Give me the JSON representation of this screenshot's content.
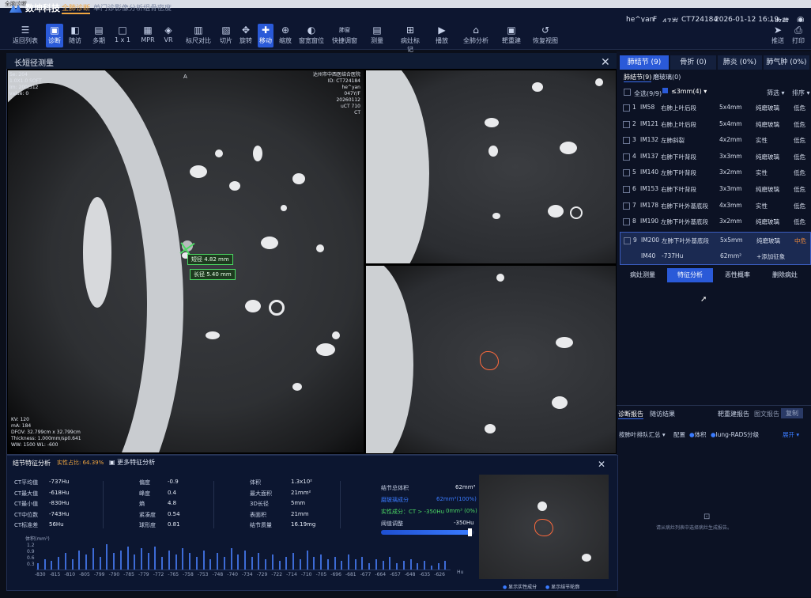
{
  "window": {
    "title": "全脑诊断"
  },
  "brand": {
    "name": "数坤科技"
  },
  "modes": [
    {
      "label": "全肺诊断",
      "active": true
    },
    {
      "label": "单门诊影像分析组",
      "active": false
    },
    {
      "label": "骨密度",
      "active": false
    }
  ],
  "patient": {
    "name": "he^yan",
    "sex": "F",
    "age": "47岁",
    "id": "CT724184",
    "datetime": "2026-01-12 16:19"
  },
  "header_actions": {
    "favorite": "收藏",
    "send": "推送",
    "print": "打印"
  },
  "toolbar": [
    {
      "label": "返回列表",
      "icon": "list-icon",
      "glyph": "☰"
    },
    {
      "label": "诊断",
      "icon": "diagnose-icon",
      "glyph": "▣",
      "active": true
    },
    {
      "label": "随访",
      "icon": "followup-icon",
      "glyph": "◧"
    },
    {
      "label": "多期",
      "icon": "multiphase-icon",
      "glyph": "▤"
    },
    {
      "label": "1 x 1",
      "icon": "layout-icon",
      "glyph": "□"
    },
    {
      "label": "MPR",
      "icon": "mpr-icon",
      "glyph": "▦"
    },
    {
      "label": "VR",
      "icon": "vr-icon",
      "glyph": "◈"
    },
    {
      "label": "标尺对比",
      "icon": "ruler-compare-icon",
      "glyph": "▥"
    },
    {
      "label": "切片",
      "icon": "slice-icon",
      "glyph": "▧"
    },
    {
      "label": "旋转",
      "icon": "rotate-icon",
      "glyph": "✥"
    },
    {
      "label": "移动",
      "icon": "move-icon",
      "glyph": "✚",
      "active": true
    },
    {
      "label": "缩放",
      "icon": "zoom-icon",
      "glyph": "⊕"
    },
    {
      "label": "窗宽窗位",
      "icon": "window-level-icon",
      "glyph": "◐"
    },
    {
      "label": "快捷调窗",
      "icon": "quick-window-icon",
      "glyph": "肺窗"
    },
    {
      "label": "测量",
      "icon": "measure-icon",
      "glyph": "▤"
    },
    {
      "label": "病灶标记",
      "icon": "lesion-mark-icon",
      "glyph": "⊞"
    },
    {
      "label": "播放",
      "icon": "play-icon",
      "glyph": "▶"
    },
    {
      "label": "全肺分析",
      "icon": "lung-analysis-icon",
      "glyph": "⌂"
    },
    {
      "label": "靶重建",
      "icon": "target-recon-icon",
      "glyph": "▣"
    },
    {
      "label": "恢复视图",
      "icon": "reset-view-icon",
      "glyph": "↺"
    }
  ],
  "viewer": {
    "title": "长短径测量",
    "orientation": "A",
    "info_left": [
      "Se: 204",
      "1.0X1.0 SOFT",
      "Im: 200/312",
      "value: 0"
    ],
    "info_right": [
      "达州市中西医结合医院",
      "ID: CT724184",
      "he^yan",
      "047Y/F",
      "20260112",
      "uCT 710",
      "CT"
    ],
    "info_bottom": [
      "KV: 120",
      "mA: 184",
      "DFOV: 32.799cm x 32.799cm",
      "Thickness: 1.000mm/sp0.641",
      "WW: 1500    WL: -600"
    ],
    "short_axis": "短径 4.82 mm",
    "long_axis": "长径 5.40 mm"
  },
  "nodule_panel": {
    "tabs": [
      {
        "label": "肺结节 (9)",
        "active": true
      },
      {
        "label": "骨折 (0)"
      },
      {
        "label": "肺炎 (0%)"
      },
      {
        "label": "肺气肿 (0%)"
      }
    ],
    "subtabs": [
      "肺结节(9)",
      "磨玻璃(0)"
    ],
    "select_all": "全选(9/9)",
    "filter_value": "≤3mm(4)",
    "filter_label": "筛选",
    "sort_label": "排序",
    "rows": [
      {
        "no": "1",
        "im": "IM58",
        "loc": "右肺上叶后段",
        "size": "5x4mm",
        "type": "纯磨玻璃",
        "risk": "低危"
      },
      {
        "no": "2",
        "im": "IM121",
        "loc": "右肺上叶后段",
        "size": "5x4mm",
        "type": "纯磨玻璃",
        "risk": "低危"
      },
      {
        "no": "3",
        "im": "IM132",
        "loc": "左肺斜裂",
        "size": "4x2mm",
        "type": "实性",
        "risk": "低危"
      },
      {
        "no": "4",
        "im": "IM137",
        "loc": "右肺下叶背段",
        "size": "3x3mm",
        "type": "纯磨玻璃",
        "risk": "低危"
      },
      {
        "no": "5",
        "im": "IM140",
        "loc": "左肺下叶背段",
        "size": "3x2mm",
        "type": "实性",
        "risk": "低危"
      },
      {
        "no": "6",
        "im": "IM153",
        "loc": "右肺下叶背段",
        "size": "3x3mm",
        "type": "纯磨玻璃",
        "risk": "低危"
      },
      {
        "no": "7",
        "im": "IM178",
        "loc": "右肺下叶外基底段",
        "size": "4x3mm",
        "type": "实性",
        "risk": "低危"
      },
      {
        "no": "8",
        "im": "IM190",
        "loc": "左肺下叶外基底段",
        "size": "3x2mm",
        "type": "纯磨玻璃",
        "risk": "低危"
      }
    ],
    "selected": {
      "no": "9",
      "im": "IM200",
      "loc": "左肺下叶外基底段",
      "size": "5x5mm",
      "type": "纯磨玻璃",
      "risk": "中危",
      "im2": "IM40",
      "hu": "-737Hu",
      "area": "62mm²",
      "add_sign": "+添加征象"
    },
    "actions": [
      {
        "label": "病灶测量",
        "active": false
      },
      {
        "label": "特征分析",
        "active": true
      },
      {
        "label": "恶性概率",
        "active": false
      },
      {
        "label": "删除病灶",
        "active": false
      }
    ]
  },
  "report_panel": {
    "tabs": [
      "诊断报告",
      "随访结果"
    ],
    "right_tabs": [
      "靶重建报告",
      "图文报告",
      "复制"
    ],
    "dropdown": "按肺叶排队汇总",
    "config": "配置",
    "check1": "体积",
    "check2": "lung-RADS分级",
    "link": "展开",
    "empty_text": "请从病灶列表中选择病灶生成报告。"
  },
  "analysis_panel": {
    "title": "结节特征分析",
    "solid_ratio": "实性占比: 64.39%",
    "more": "更多特征分析",
    "ct_stats": [
      {
        "k": "CT平均值",
        "v": "-737Hu"
      },
      {
        "k": "CT最大值",
        "v": "-618Hu"
      },
      {
        "k": "CT最小值",
        "v": "-830Hu"
      },
      {
        "k": "CT中位数",
        "v": "-743Hu"
      },
      {
        "k": "CT标准差",
        "v": "56Hu"
      }
    ],
    "shape_stats": [
      {
        "k": "偏度",
        "v": "-0.9"
      },
      {
        "k": "峰度",
        "v": "0.4"
      },
      {
        "k": "熵",
        "v": "4.8"
      },
      {
        "k": "紧凑度",
        "v": "0.54"
      },
      {
        "k": "球形度",
        "v": "0.81"
      }
    ],
    "size_stats": [
      {
        "k": "体积",
        "v": "1.3x10²"
      },
      {
        "k": "最大面积",
        "v": "21mm²"
      },
      {
        "k": "3D长径",
        "v": "5mm"
      },
      {
        "k": "表面积",
        "v": "21mm"
      },
      {
        "k": "结节质量",
        "v": "16.19mg"
      }
    ],
    "vol": {
      "k": "结节总体积",
      "v": "62mm³"
    },
    "ggo": {
      "k": "磨玻璃成分",
      "v": "62mm³(100%)"
    },
    "solid": {
      "k": "实性成分：CT > -350Hu",
      "v": "0mm³ (0%)"
    },
    "threshold": {
      "k": "阈值调整",
      "v": "-350Hu"
    },
    "hist_ylabel": "体积(mm³)",
    "hist_unit": "Hu",
    "show_ggo": "显示实性成分",
    "show_contour": "显示结节轮廓"
  },
  "chart_data": {
    "type": "bar",
    "ylabel": "体积(mm³)",
    "xlabel": "Hu",
    "x_ticks": [
      "-830",
      "-815",
      "-810",
      "-805",
      "-799",
      "-790",
      "-785",
      "-779",
      "-772",
      "-765",
      "-758",
      "-753",
      "-748",
      "-740",
      "-734",
      "-729",
      "-722",
      "-714",
      "-710",
      "-705",
      "-696",
      "-681",
      "-677",
      "-664",
      "-657",
      "-648",
      "-635",
      "-626"
    ],
    "values": [
      0.3,
      0.5,
      0.4,
      0.6,
      0.8,
      0.5,
      0.9,
      0.7,
      1.0,
      0.6,
      1.2,
      0.8,
      0.9,
      1.1,
      0.7,
      1.0,
      0.8,
      1.1,
      0.6,
      0.9,
      0.7,
      1.0,
      0.8,
      0.6,
      0.9,
      0.5,
      0.8,
      0.6,
      1.0,
      0.7,
      0.9,
      0.6,
      0.8,
      0.5,
      0.7,
      0.4,
      0.6,
      0.8,
      0.5,
      0.9,
      0.6,
      0.7,
      0.5,
      0.6,
      0.4,
      0.7,
      0.5,
      0.6,
      0.3,
      0.5,
      0.4,
      0.6,
      0.3,
      0.4,
      0.5,
      0.3,
      0.4,
      0.2,
      0.3,
      0.4
    ],
    "y_ticks": [
      "1.2",
      "0.9",
      "0.6",
      "0.3"
    ],
    "ylim": [
      0,
      1.2
    ]
  }
}
